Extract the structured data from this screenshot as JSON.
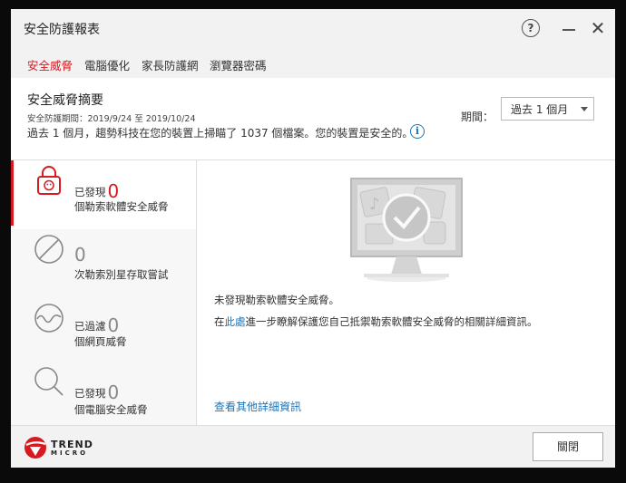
{
  "window": {
    "title": "安全防護報表"
  },
  "titlebar": {
    "help_glyph": "?",
    "close_glyph": "✕"
  },
  "tabs": [
    {
      "label": "安全威脅",
      "active": true
    },
    {
      "label": "電腦優化"
    },
    {
      "label": "家長防護網"
    },
    {
      "label": "瀏覽器密碼"
    }
  ],
  "header": {
    "title": "安全威脅摘要",
    "period_text": "安全防護期間：2019/9/24 至 2019/10/24",
    "summary": "過去 1 個月，趨勢科技在您的裝置上掃瞄了 1037 個檔案。您的裝置是安全的。",
    "info_glyph": "i",
    "period_label": "期間：",
    "period_value": "過去 1 個月"
  },
  "stats": [
    {
      "icon": "ransomware-lock-icon",
      "line1": "已發現",
      "count": "0",
      "line2": "個勒索軟體安全威脅"
    },
    {
      "icon": "blocked-circle-icon",
      "count": "0",
      "line2": "次勒索別星存取嘗試"
    },
    {
      "icon": "web-wave-icon",
      "line1": "已過濾",
      "count": "0",
      "line2": "個網頁威脅"
    },
    {
      "icon": "magnifier-icon",
      "line1": "已發現",
      "count": "0",
      "line2": "個電腦安全威脅"
    }
  ],
  "main": {
    "msg1": "未發現勒索軟體安全威脅。",
    "msg2_pre": "在",
    "msg2_link": "此處",
    "msg2_post": "進一步瞭解保護您自己抵禦勒索軟體安全威脅的相關詳細資訊。",
    "more_link": "查看其他詳細資訊"
  },
  "footer": {
    "logo_line1": "TREND",
    "logo_line2": "MICRO",
    "close_label": "關閉"
  },
  "colors": {
    "accent": "#d71920",
    "link": "#1a73b8"
  }
}
